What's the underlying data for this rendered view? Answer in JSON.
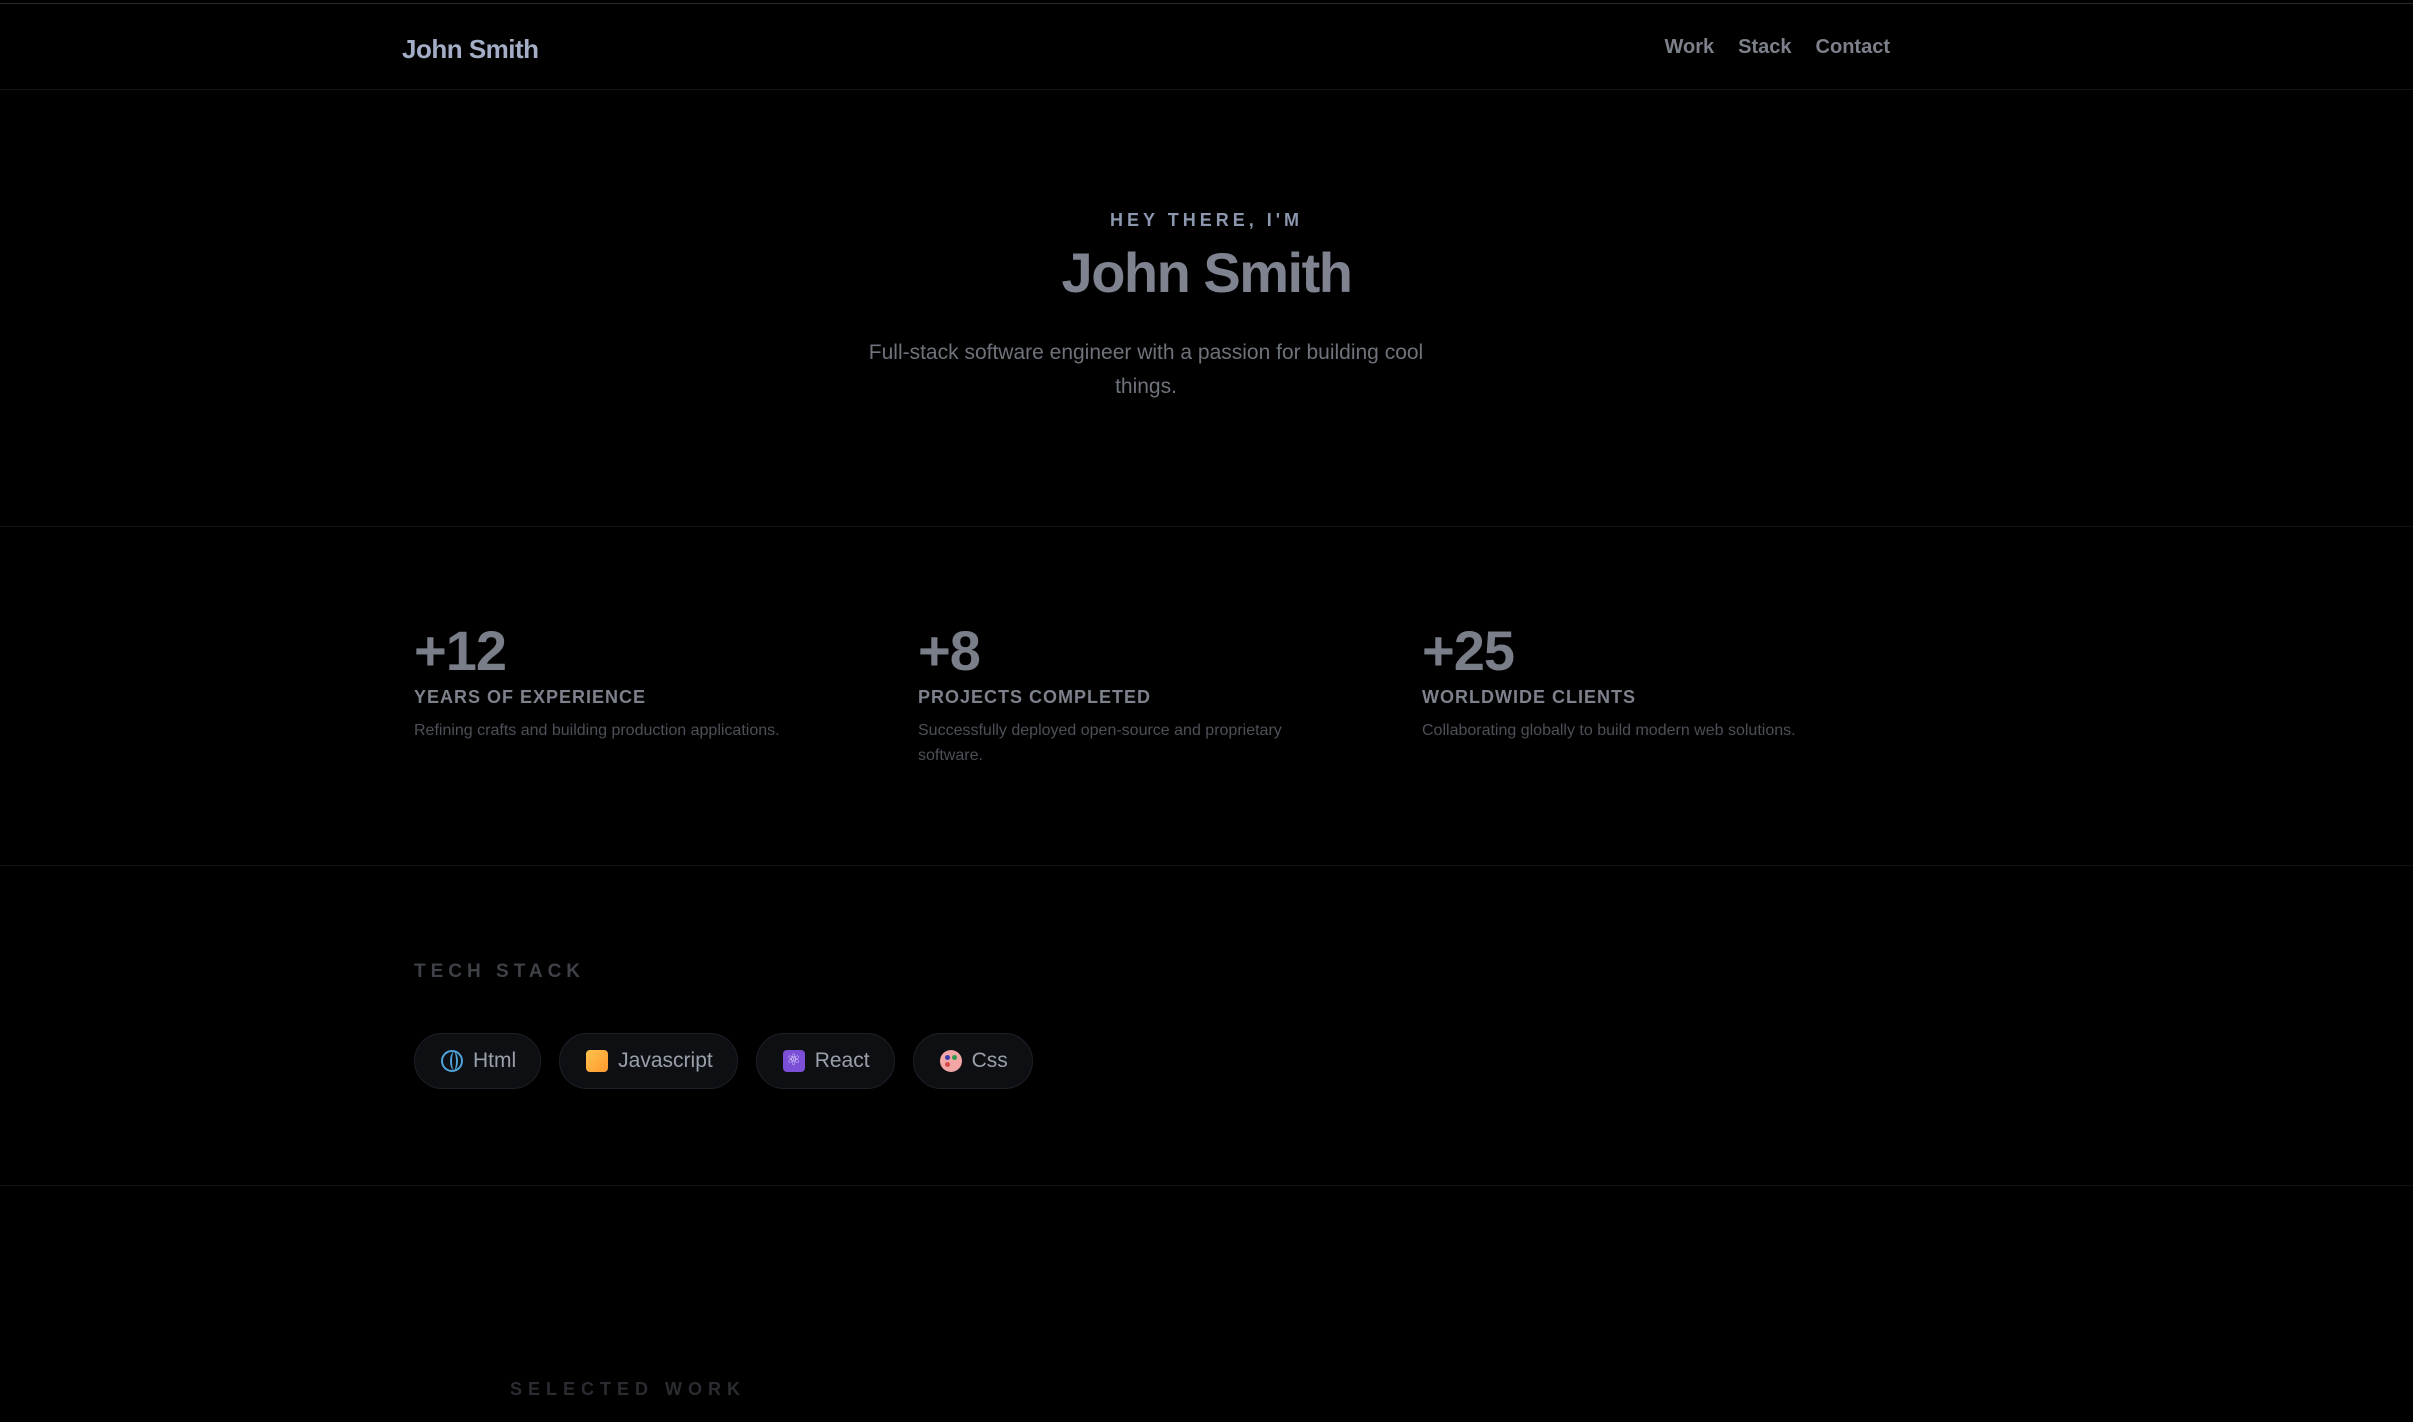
{
  "nav": {
    "brand": "John Smith",
    "links": [
      "Work",
      "Stack",
      "Contact"
    ]
  },
  "hero": {
    "eyebrow": "HEY THERE, I'M",
    "title": "John Smith",
    "subtitle": "Full-stack software engineer with a passion for building cool things."
  },
  "stats": [
    {
      "value": "+12",
      "label": "YEARS OF EXPERIENCE",
      "description": "Refining crafts and building production applications."
    },
    {
      "value": "+8",
      "label": "PROJECTS COMPLETED",
      "description": "Successfully deployed open-source and proprietary software."
    },
    {
      "value": "+25",
      "label": "WORLDWIDE CLIENTS",
      "description": "Collaborating globally to build modern web solutions."
    }
  ],
  "stack": {
    "title": "TECH STACK",
    "chips": [
      {
        "label": "Html",
        "icon": "globe-icon"
      },
      {
        "label": "Javascript",
        "icon": "orange-square-icon"
      },
      {
        "label": "React",
        "icon": "atom-icon"
      },
      {
        "label": "Css",
        "icon": "palette-icon"
      }
    ]
  },
  "work": {
    "title": "SELECTED WORK"
  },
  "colors": {
    "background": "#000000",
    "brand": "#a3aec6",
    "eyebrow": "#8c96ae",
    "heading": "#7f8390",
    "chip_bg": "#0d0f13"
  }
}
